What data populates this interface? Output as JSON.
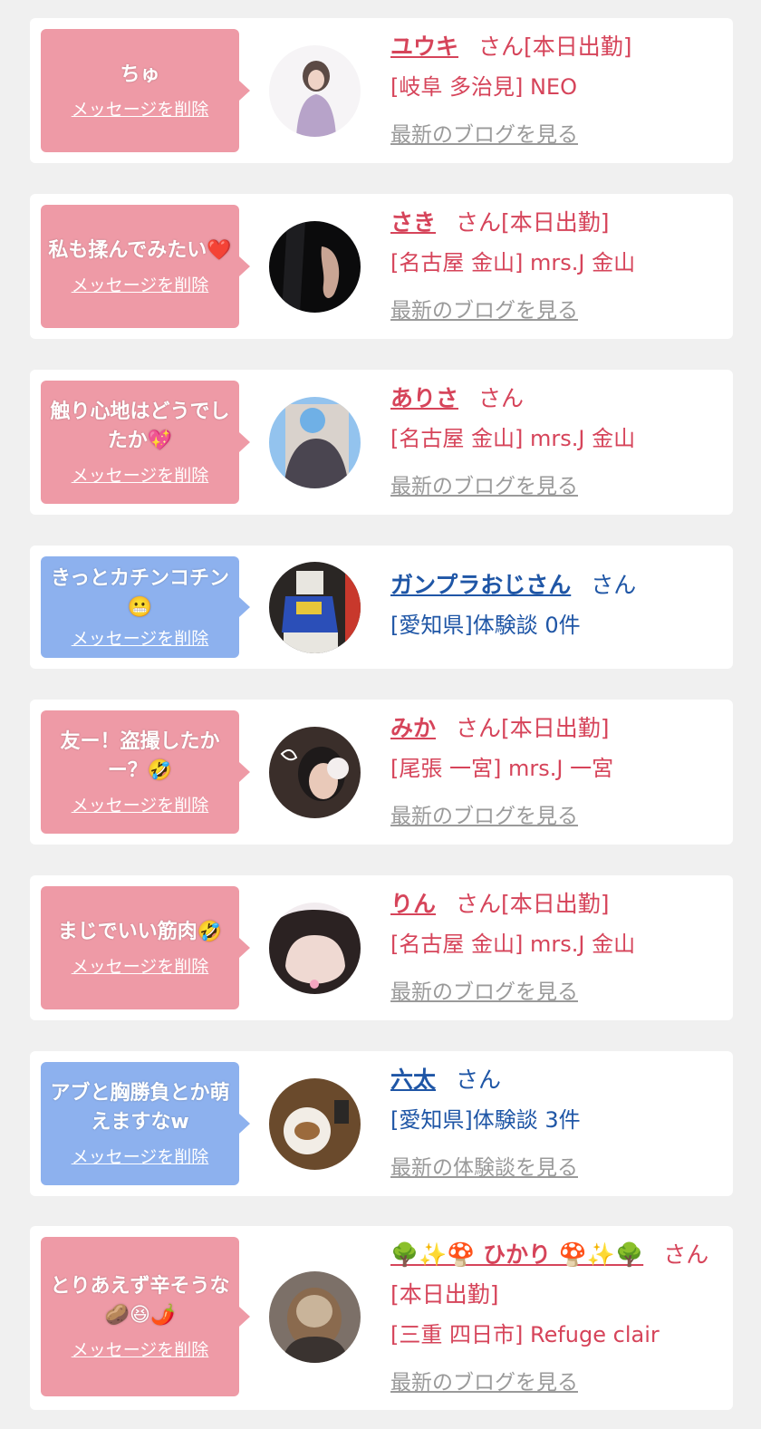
{
  "delete_label": "メッセージを削除",
  "colors": {
    "pink_bubble": "#ee9aa6",
    "blue_bubble": "#8db1ee",
    "cast_text": "#d6445a",
    "user_text": "#1f56a6",
    "link_gray": "#9a9a9a"
  },
  "messages": [
    {
      "msg": "ちゅ",
      "name": "ユウキ",
      "suffix": "さん[本日出勤]",
      "sub": "[岐阜 多治見] NEO",
      "link": "最新のブログを見る",
      "kind": "cast"
    },
    {
      "msg": "私も揉んでみたい❤️",
      "name": "さき",
      "suffix": "さん[本日出勤]",
      "sub": "[名古屋 金山] mrs.J 金山",
      "link": "最新のブログを見る",
      "kind": "cast"
    },
    {
      "msg": "触り心地はどうでしたか💖",
      "name": "ありさ",
      "suffix": "さん",
      "sub": "[名古屋 金山] mrs.J 金山",
      "link": "最新のブログを見る",
      "kind": "cast"
    },
    {
      "msg": "きっとカチンコチン😬",
      "name": "ガンプラおじさん",
      "suffix": "さん",
      "sub": "[愛知県]体験談 0件",
      "link": "",
      "kind": "user"
    },
    {
      "msg": "友ー！盗撮したかー？🤣",
      "name": "みか",
      "suffix": "さん[本日出勤]",
      "sub": "[尾張 一宮] mrs.J 一宮",
      "link": "最新のブログを見る",
      "kind": "cast"
    },
    {
      "msg": "まじでいい筋肉🤣",
      "name": "りん",
      "suffix": "さん[本日出勤]",
      "sub": "[名古屋 金山] mrs.J 金山",
      "link": "最新のブログを見る",
      "kind": "cast"
    },
    {
      "msg": "アブと胸勝負とか萌えますなw",
      "name": "六太",
      "suffix": "さん",
      "sub": "[愛知県]体験談 3件",
      "link": "最新の体験談を見る",
      "kind": "user"
    },
    {
      "msg": "とりあえず辛そうな🥔😆🌶️",
      "name": "🌳✨🍄 ひかり 🍄✨🌳",
      "suffix": "さん[本日出勤]",
      "sub": "[三重 四日市] Refuge clair",
      "link": "最新のブログを見る",
      "kind": "cast"
    }
  ]
}
